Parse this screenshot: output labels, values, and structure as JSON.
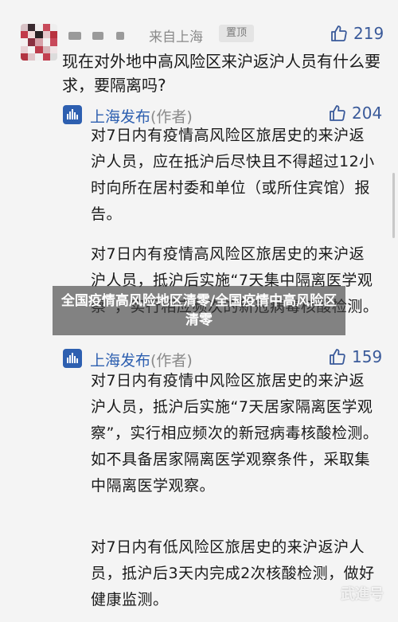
{
  "question": {
    "origin": "来自上海",
    "pinned_label": "置顶",
    "likes": "219",
    "text": "现在对外地中高风险区来沪返沪人员有什么要求，要隔离吗?"
  },
  "replies": [
    {
      "author": "上海发布",
      "role": "(作者)",
      "likes": "204",
      "paragraphs": [
        "对7日内有疫情高风险区旅居史的来沪返沪人员，应在抵沪后尽快且不得超过12小时向所在居村委和单位（或所住宾馆）报告。",
        "对7日内有疫情高风险区旅居史的来沪返沪人员，抵沪后实施“7天集中隔离医学观察”，实行相应频次的新冠病毒核酸检测。"
      ]
    },
    {
      "author": "上海发布",
      "role": "(作者)",
      "likes": "159",
      "paragraphs": [
        "对7日内有疫情中风险区旅居史的来沪返沪人员，抵沪后实施“7天居家隔离医学观察”，实行相应频次的新冠病毒核酸检测。如不具备居家隔离医学观察条件，采取集中隔离医学观察。",
        "对7日内有低风险区旅居史的来沪返沪人员，抵沪后3天内完成2次核酸检测，做好健康监测。"
      ]
    }
  ],
  "banner": "全国疫情高风险地区清零/全国疫情中高风险区清零",
  "watermark": "武進号",
  "colors": {
    "accent": "#2d5fb0",
    "like": "#3a5a9a",
    "background": "#f4f4f4",
    "muted": "#8a8a8a"
  },
  "icons": {
    "like": "thumbs-up-icon",
    "author_logo": "shanghai-fabu-logo"
  }
}
